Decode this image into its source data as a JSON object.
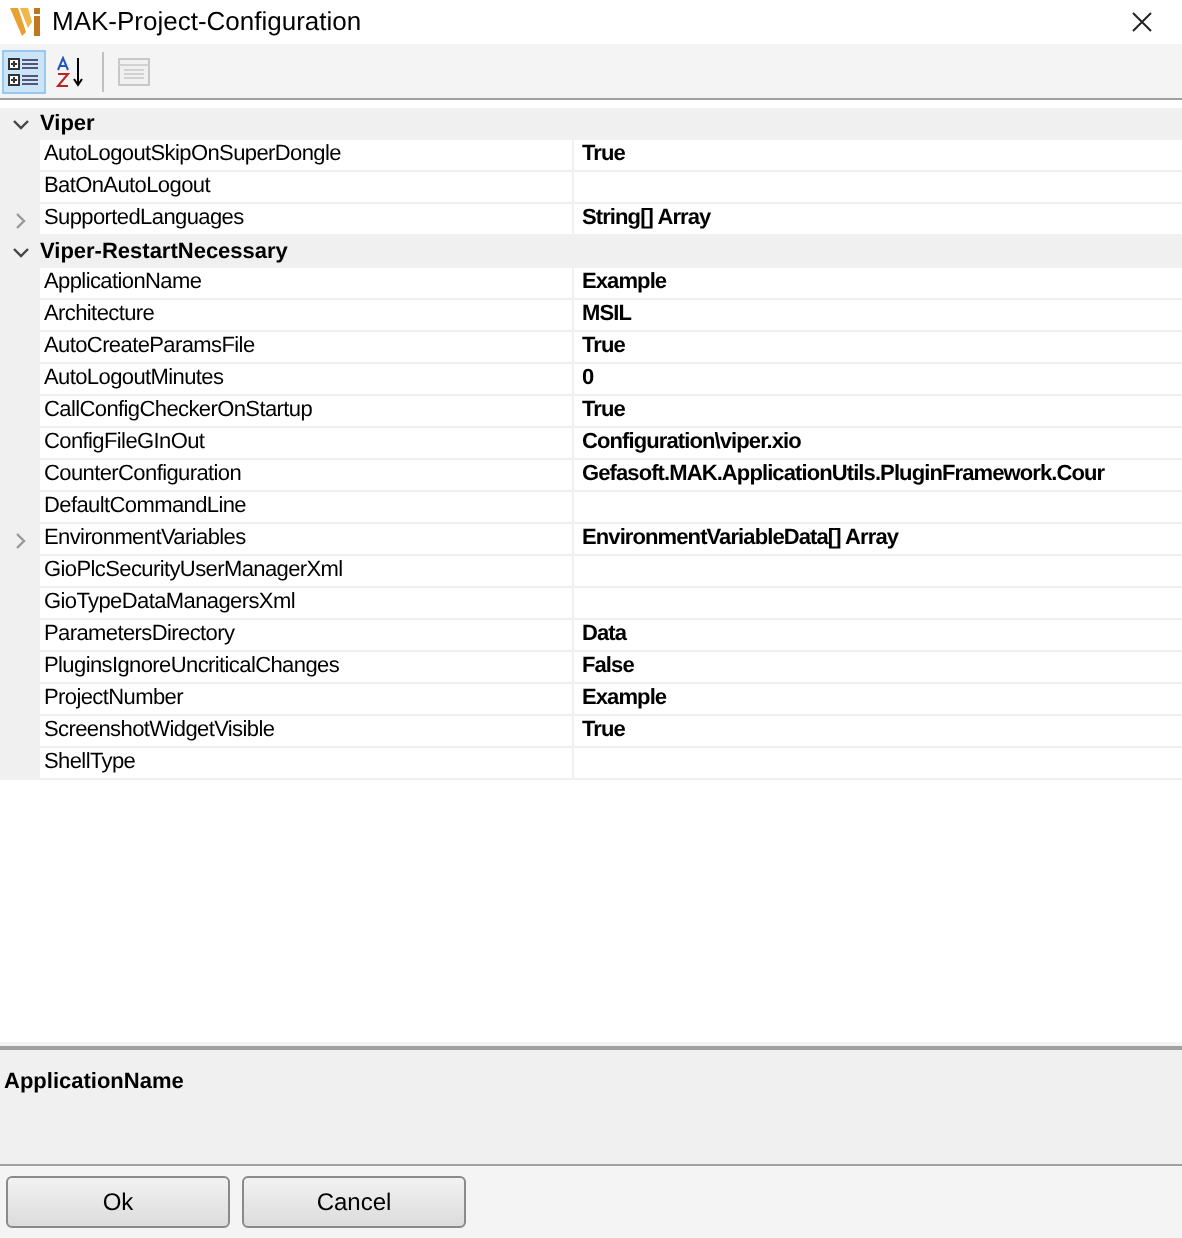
{
  "window": {
    "title": "MAK-Project-Configuration"
  },
  "toolbar": [
    {
      "kind": "categorized",
      "selected": true,
      "disabled": false
    },
    {
      "kind": "alphabetical",
      "selected": false,
      "disabled": false
    },
    {
      "kind": "property_pages",
      "selected": false,
      "disabled": true
    }
  ],
  "categories": [
    {
      "name": "Viper",
      "expanded": true,
      "properties": [
        {
          "name": "AutoLogoutSkipOnSuperDongle",
          "value": "True",
          "kind": "plain"
        },
        {
          "name": "BatOnAutoLogout",
          "kind": "plain"
        },
        {
          "name": "SupportedLanguages",
          "value": "String[] Array",
          "kind": "expandable",
          "expanded": false
        }
      ]
    },
    {
      "name": "Viper-RestartNecessary",
      "expanded": true,
      "properties": [
        {
          "name": "ApplicationName",
          "value": "Example",
          "kind": "plain"
        },
        {
          "name": "Architecture",
          "value": "MSIL",
          "kind": "plain"
        },
        {
          "name": "AutoCreateParamsFile",
          "value": "True",
          "kind": "plain"
        },
        {
          "name": "AutoLogoutMinutes",
          "value": "0",
          "kind": "plain"
        },
        {
          "name": "CallConfigCheckerOnStartup",
          "value": "True",
          "kind": "plain"
        },
        {
          "name": "ConfigFileGInOut",
          "value": "Configuration\\viper.xio",
          "kind": "plain"
        },
        {
          "name": "CounterConfiguration",
          "value": "Gefasoft.MAK.ApplicationUtils.PluginFramework.Cour",
          "kind": "plain"
        },
        {
          "name": "DefaultCommandLine",
          "kind": "plain"
        },
        {
          "name": "EnvironmentVariables",
          "value": "EnvironmentVariableData[] Array",
          "kind": "expandable",
          "expanded": false
        },
        {
          "name": "GioPlcSecurityUserManagerXml",
          "kind": "plain"
        },
        {
          "name": "GioTypeDataManagersXml",
          "kind": "plain"
        },
        {
          "name": "ParametersDirectory",
          "value": "Data",
          "kind": "plain"
        },
        {
          "name": "PluginsIgnoreUncriticalChanges",
          "value": "False",
          "kind": "plain"
        },
        {
          "name": "ProjectNumber",
          "value": "Example",
          "kind": "plain"
        },
        {
          "name": "ScreenshotWidgetVisible",
          "value": "True",
          "kind": "plain"
        },
        {
          "name": "ShellType",
          "kind": "plain"
        }
      ]
    }
  ],
  "description": {
    "title": "ApplicationName"
  },
  "buttons": [
    "Ok",
    "Cancel"
  ]
}
